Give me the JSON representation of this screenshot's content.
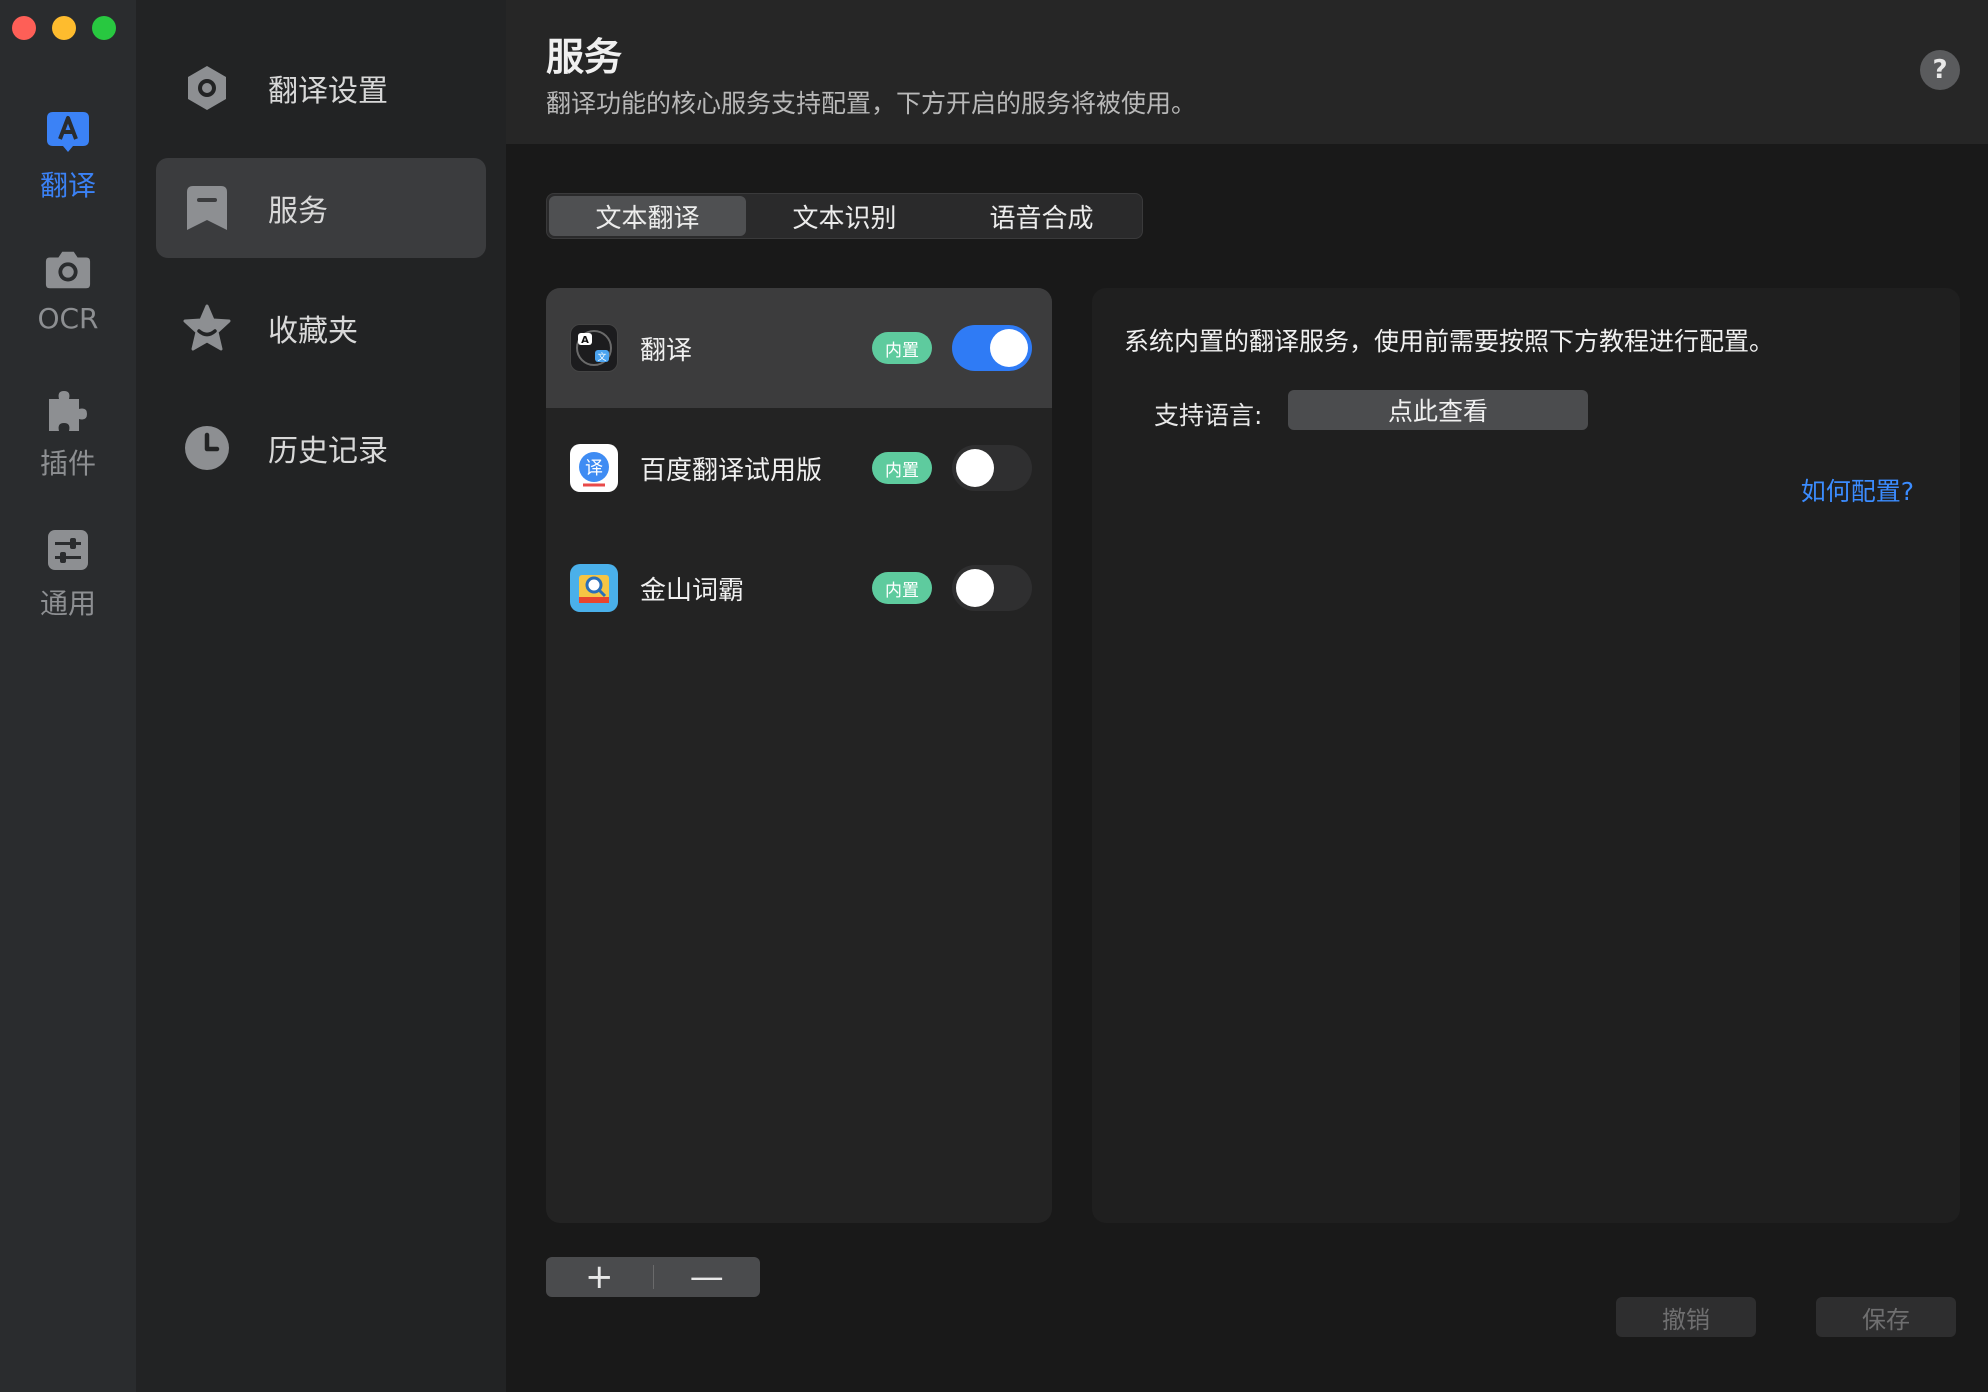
{
  "window": {
    "traffic_lights": [
      "close",
      "minimize",
      "zoom"
    ]
  },
  "rail": {
    "items": [
      {
        "label": "翻译",
        "icon": "translate-icon",
        "active": true
      },
      {
        "label": "OCR",
        "icon": "camera-icon",
        "active": false
      },
      {
        "label": "插件",
        "icon": "puzzle-icon",
        "active": false
      },
      {
        "label": "通用",
        "icon": "sliders-icon",
        "active": false
      }
    ],
    "accent": "#3b82f6"
  },
  "sidebar": {
    "items": [
      {
        "label": "翻译设置",
        "icon": "gear-icon",
        "active": false
      },
      {
        "label": "服务",
        "icon": "bookmark-icon",
        "active": true
      },
      {
        "label": "收藏夹",
        "icon": "star-icon",
        "active": false
      },
      {
        "label": "历史记录",
        "icon": "clock-icon",
        "active": false
      }
    ]
  },
  "header": {
    "title": "服务",
    "subtitle": "翻译功能的核心服务支持配置，下方开启的服务将被使用。",
    "help": "?"
  },
  "tabs": [
    {
      "label": "文本翻译",
      "active": true
    },
    {
      "label": "文本识别",
      "active": false
    },
    {
      "label": "语音合成",
      "active": false
    }
  ],
  "services": [
    {
      "name": "翻译",
      "badge": "内置",
      "enabled": true,
      "icon": "system-translate-icon"
    },
    {
      "name": "百度翻译试用版",
      "badge": "内置",
      "enabled": false,
      "icon": "baidu-translate-icon"
    },
    {
      "name": "金山词霸",
      "badge": "内置",
      "enabled": false,
      "icon": "iciba-icon"
    }
  ],
  "list_controls": {
    "add": "+",
    "remove": "—"
  },
  "detail": {
    "description": "系统内置的翻译服务，使用前需要按照下方教程进行配置。",
    "lang_label": "支持语言:",
    "lang_button": "点此查看",
    "how_link": "如何配置?"
  },
  "footer": {
    "cancel": "撤销",
    "save": "保存"
  },
  "colors": {
    "toggle_on": "#2f7bf5",
    "badge": "#5ecb9e",
    "link": "#3b8cff"
  }
}
